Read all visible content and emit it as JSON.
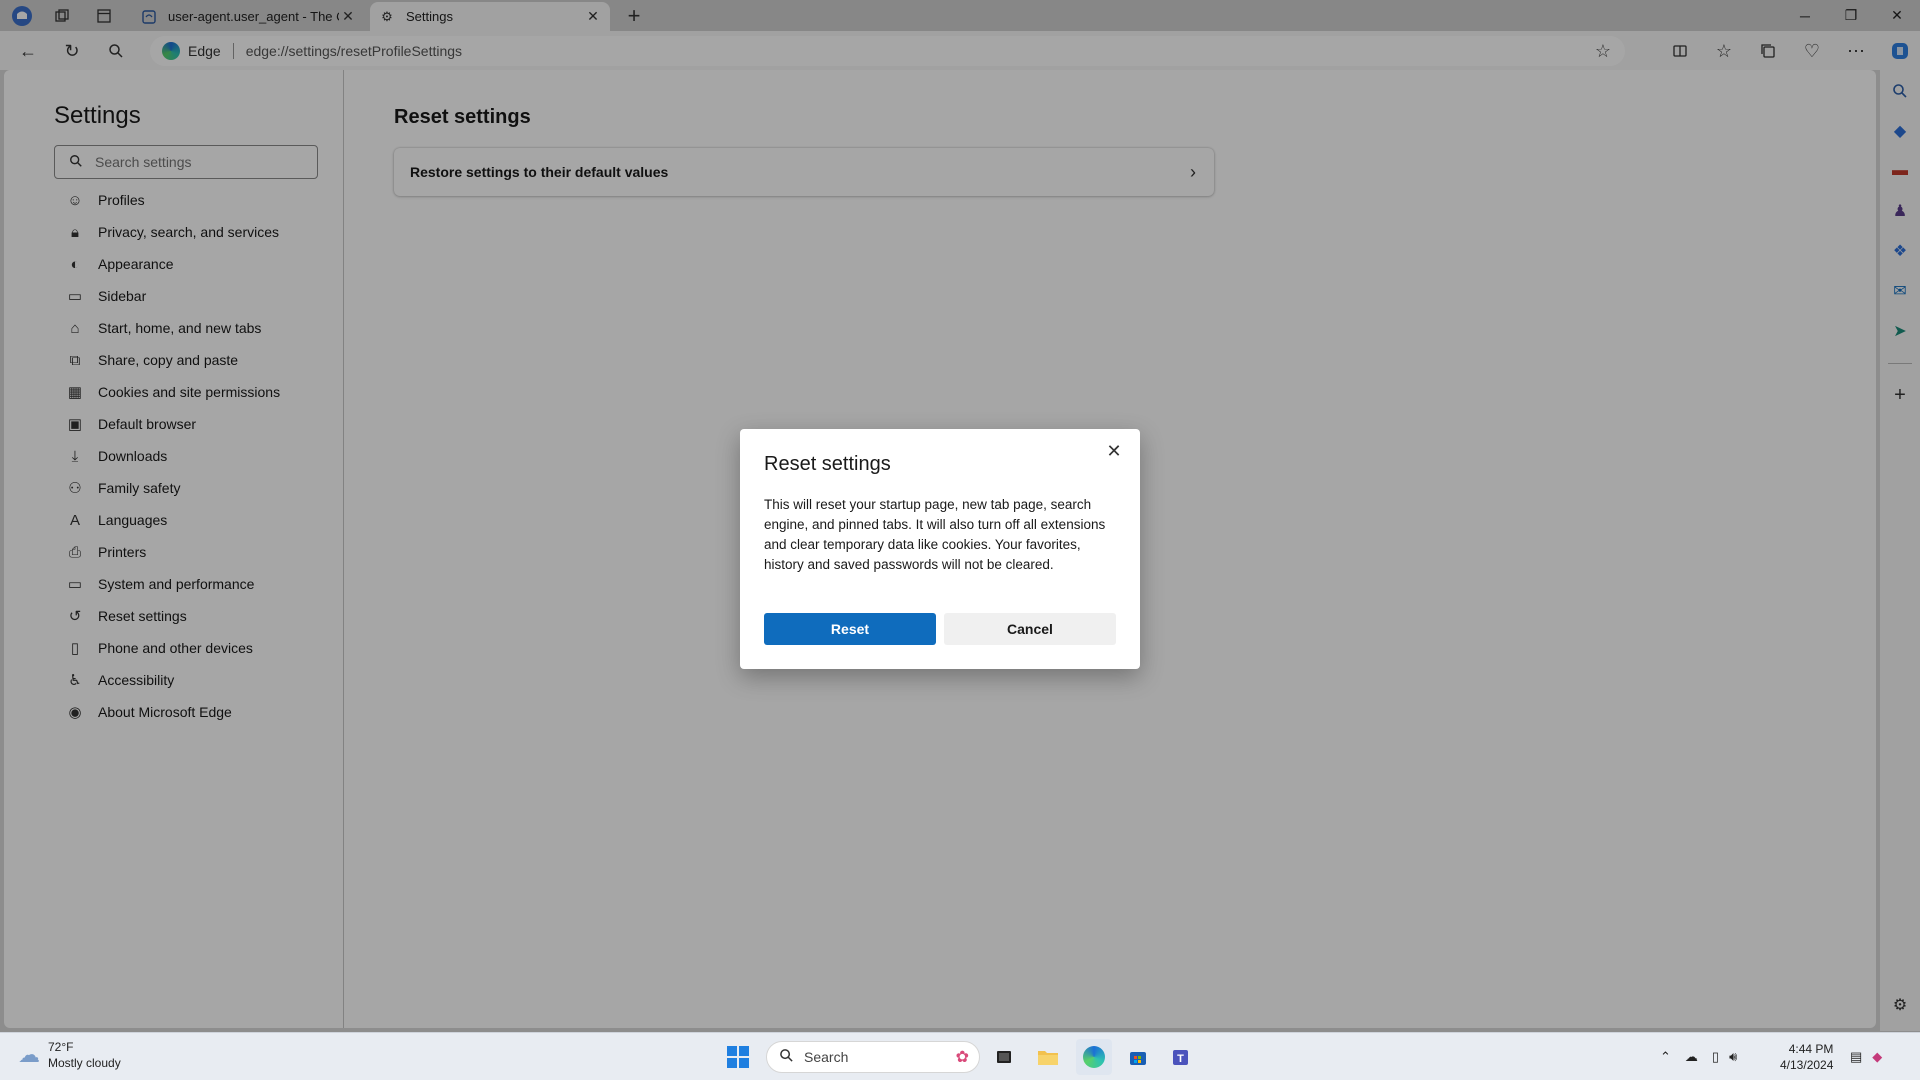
{
  "browser": {
    "tabs": [
      {
        "title": "user-agent.user_agent - The Coll",
        "icon": "document-icon"
      },
      {
        "title": "Settings",
        "icon": "gear-icon"
      }
    ],
    "address": {
      "site_label": "Edge",
      "url": "edge://settings/resetProfileSettings"
    }
  },
  "settings": {
    "title": "Settings",
    "search_placeholder": "Search settings",
    "nav": [
      {
        "label": "Profiles",
        "icon": "profile-icon"
      },
      {
        "label": "Privacy, search, and services",
        "icon": "lock-icon"
      },
      {
        "label": "Appearance",
        "icon": "appearance-icon"
      },
      {
        "label": "Sidebar",
        "icon": "sidebar-icon"
      },
      {
        "label": "Start, home, and new tabs",
        "icon": "home-icon"
      },
      {
        "label": "Share, copy and paste",
        "icon": "share-icon"
      },
      {
        "label": "Cookies and site permissions",
        "icon": "cookie-icon"
      },
      {
        "label": "Default browser",
        "icon": "browser-icon"
      },
      {
        "label": "Downloads",
        "icon": "download-icon"
      },
      {
        "label": "Family safety",
        "icon": "family-icon"
      },
      {
        "label": "Languages",
        "icon": "language-icon"
      },
      {
        "label": "Printers",
        "icon": "printer-icon"
      },
      {
        "label": "System and performance",
        "icon": "system-icon"
      },
      {
        "label": "Reset settings",
        "icon": "reset-icon"
      },
      {
        "label": "Phone and other devices",
        "icon": "phone-icon"
      },
      {
        "label": "Accessibility",
        "icon": "accessibility-icon"
      },
      {
        "label": "About Microsoft Edge",
        "icon": "edge-icon"
      }
    ],
    "main_title": "Reset settings",
    "card_label": "Restore settings to their default values"
  },
  "dialog": {
    "title": "Reset settings",
    "body": "This will reset your startup page, new tab page, search engine, and pinned tabs. It will also turn off all extensions and clear temporary data like cookies. Your favorites, history and saved passwords will not be cleared.",
    "reset_label": "Reset",
    "cancel_label": "Cancel"
  },
  "taskbar": {
    "weather_temp": "72°F",
    "weather_desc": "Mostly cloudy",
    "search_label": "Search",
    "time": "4:44 PM",
    "date": "4/13/2024"
  },
  "colors": {
    "accent": "#0f6cbd"
  }
}
